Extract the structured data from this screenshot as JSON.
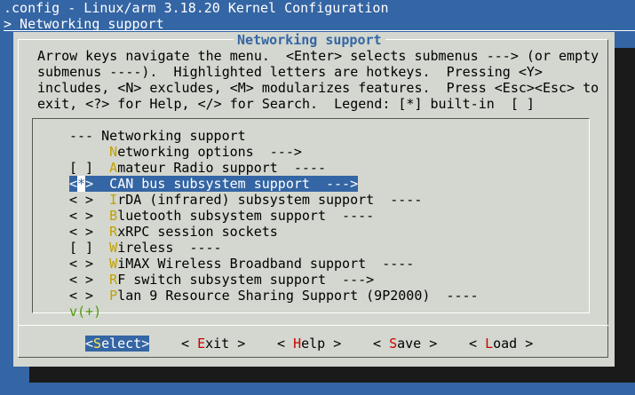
{
  "window": {
    "title": ".config - Linux/arm 3.18.20 Kernel Configuration",
    "breadcrumb": "> Networking support"
  },
  "dialog": {
    "title": "Networking support",
    "help_lines": [
      "Arrow keys navigate the menu.  <Enter> selects submenus ---> (or empty",
      "submenus ----).  Highlighted letters are hotkeys.  Pressing <Y>",
      "includes, <N> excludes, <M> modularizes features.  Press <Esc><Esc> to",
      "exit, <?> for Help, </> for Search.  Legend: [*] built-in  [ ]"
    ]
  },
  "menu": {
    "header": "--- Networking support",
    "items": [
      {
        "state": "   ",
        "hotkey": "N",
        "rest": "etworking options  --->"
      },
      {
        "state": "[ ]",
        "hotkey": "A",
        "rest": "mateur Radio support  ----"
      },
      {
        "state": "<*>",
        "hotkey": "C",
        "rest": "AN bus subsystem support  --->"
      },
      {
        "state": "< >",
        "hotkey": "I",
        "rest": "rDA (infrared) subsystem support  ----"
      },
      {
        "state": "< >",
        "hotkey": "B",
        "rest": "luetooth subsystem support  ----"
      },
      {
        "state": "< >",
        "hotkey": "R",
        "rest": "xRPC session sockets"
      },
      {
        "state": "[ ]",
        "hotkey": "W",
        "rest": "ireless  ----"
      },
      {
        "state": "< >",
        "hotkey": "W",
        "rest": "iMAX Wireless Broadband support  ----"
      },
      {
        "state": "< >",
        "hotkey": "R",
        "rest": "F switch subsystem support  --->"
      },
      {
        "state": "< >",
        "hotkey": "P",
        "rest": "lan 9 Resource Sharing Support (9P2000)  ----"
      }
    ],
    "more_indicator": "v(+)"
  },
  "buttons": [
    {
      "open": "<",
      "hotkey": "S",
      "rest": "elect",
      "close": ">"
    },
    {
      "open": "< ",
      "hotkey": "E",
      "rest": "xit",
      "close": " >"
    },
    {
      "open": "< ",
      "hotkey": "H",
      "rest": "elp",
      "close": " >"
    },
    {
      "open": "< ",
      "hotkey": "S",
      "rest": "ave",
      "close": " >"
    },
    {
      "open": "< ",
      "hotkey": "L",
      "rest": "oad",
      "close": " >"
    }
  ]
}
